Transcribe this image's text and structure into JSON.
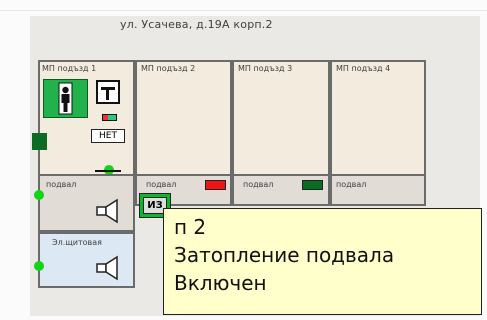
{
  "address": "ул. Усачева, д.19А корп.2",
  "entrances": [
    {
      "label": "МП подъзд 1"
    },
    {
      "label": "МП подъзд 2"
    },
    {
      "label": "МП подъзд 3"
    },
    {
      "label": "МП подъзд 4"
    }
  ],
  "basements": [
    {
      "label": "подвал"
    },
    {
      "label": "подвал"
    },
    {
      "label": "подвал"
    },
    {
      "label": "подвал"
    }
  ],
  "room": {
    "label": "Эл.щитовая"
  },
  "status_chip": "НЕТ",
  "iz_label": "ИЗ",
  "tooltip": {
    "line1": "п 2",
    "line2": "Затопление подвала",
    "line3": "Включен"
  }
}
